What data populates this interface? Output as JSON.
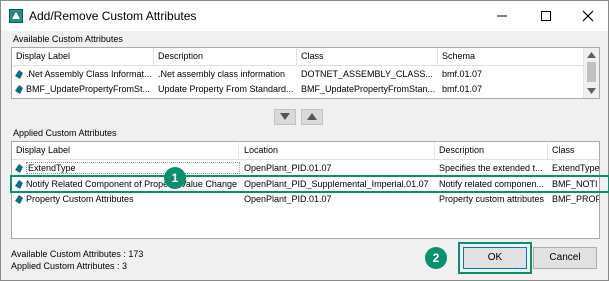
{
  "window": {
    "title": "Add/Remove Custom Attributes"
  },
  "available": {
    "group_label": "Available Custom Attributes",
    "columns": [
      "Display Label",
      "Description",
      "Class",
      "Schema"
    ],
    "rows": [
      [
        ".Net Assembly Class Informat...",
        ".Net assembly class information",
        "DOTNET_ASSEMBLY_CLASS...",
        "bmf.01.07"
      ],
      [
        "BMF_UpdatePropertyFromSt...",
        "Update Property From Standard...",
        "BMF_UpdatePropertyFromStan...",
        "bmf.01.07"
      ]
    ]
  },
  "move_buttons": {
    "down_icon": "triangle-down-icon",
    "up_icon": "triangle-up-icon"
  },
  "applied": {
    "group_label": "Applied Custom Attributes",
    "columns": [
      "Display Label",
      "Location",
      "Description",
      "Class"
    ],
    "rows": [
      [
        "ExtendType",
        "OpenPlant_PID.01.07",
        "Specifies the extended t...",
        "ExtendType"
      ],
      [
        "Notify Related Component of Property Value Change",
        "OpenPlant_PID_Supplemental_Imperial.01.07",
        "Notify related componen...",
        "BMF_NOTI"
      ],
      [
        "Property Custom Attributes",
        "OpenPlant_PID.01.07",
        "Property custom attributes",
        "BMF_PROP"
      ]
    ]
  },
  "status": {
    "available_count": "Available Custom Attributes : 173",
    "applied_count": "Applied Custom Attributes : 3"
  },
  "buttons": {
    "ok": "OK",
    "cancel": "Cancel"
  },
  "callouts": {
    "one": "1",
    "two": "2"
  },
  "colors": {
    "callout_accent": "#0b8f6f",
    "row_icon": "#0a6e8a"
  }
}
